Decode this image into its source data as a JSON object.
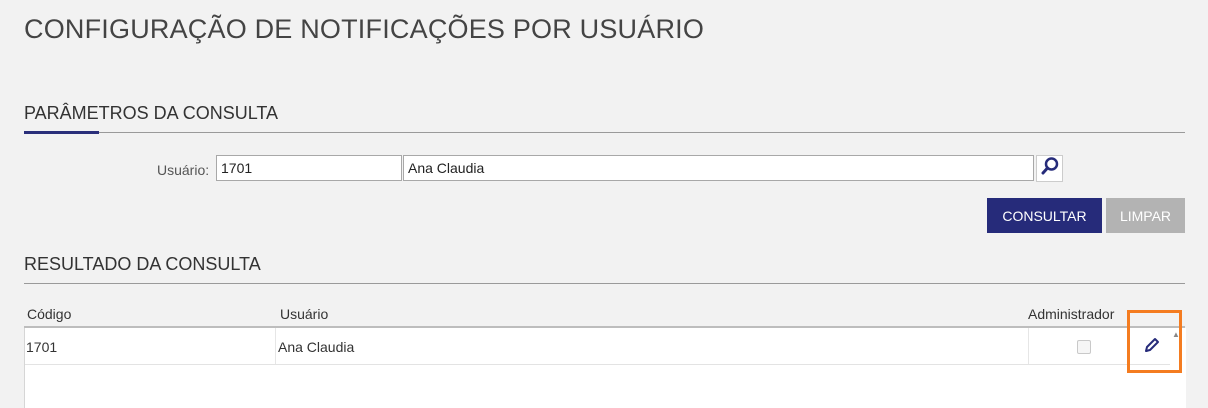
{
  "page": {
    "title": "CONFIGURAÇÃO DE NOTIFICAÇÕES POR USUÁRIO"
  },
  "params": {
    "section_title": "PARÂMETROS DA CONSULTA",
    "user_label": "Usuário:",
    "user_code_value": "1701",
    "user_name_value": "Ana Claudia",
    "search_icon": "magnifier-icon",
    "consult_label": "CONSULTAR",
    "clear_label": "LIMPAR"
  },
  "results": {
    "section_title": "RESULTADO DA CONSULTA",
    "columns": {
      "code": "Código",
      "user": "Usuário",
      "admin": "Administrador"
    },
    "rows": [
      {
        "code": "1701",
        "user": "Ana Claudia",
        "admin": false,
        "edit_icon": "pencil-icon"
      }
    ]
  },
  "colors": {
    "accent": "#262b7a",
    "disabled_button": "#b3b3b3",
    "highlight": "#f47c20"
  }
}
